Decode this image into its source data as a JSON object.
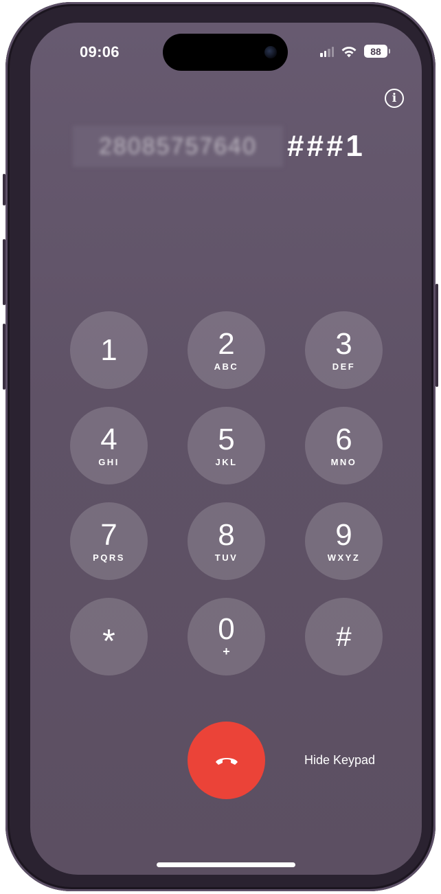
{
  "status_bar": {
    "time": "09:06",
    "battery": "88",
    "icons": [
      "cellular-signal-icon",
      "wifi-icon",
      "battery-icon"
    ]
  },
  "call": {
    "number_hidden": "28085757640",
    "dialed_suffix": "###1",
    "info_icon": "info-icon"
  },
  "keypad": {
    "keys": [
      {
        "digit": "1",
        "letters": ""
      },
      {
        "digit": "2",
        "letters": "ABC"
      },
      {
        "digit": "3",
        "letters": "DEF"
      },
      {
        "digit": "4",
        "letters": "GHI"
      },
      {
        "digit": "5",
        "letters": "JKL"
      },
      {
        "digit": "6",
        "letters": "MNO"
      },
      {
        "digit": "7",
        "letters": "PQRS"
      },
      {
        "digit": "8",
        "letters": "TUV"
      },
      {
        "digit": "9",
        "letters": "WXYZ"
      },
      {
        "digit": "*",
        "letters": ""
      },
      {
        "digit": "0",
        "letters": "+"
      },
      {
        "digit": "#",
        "letters": ""
      }
    ]
  },
  "actions": {
    "end_call_icon": "end-call-icon",
    "hide_keypad_label": "Hide Keypad"
  },
  "colors": {
    "screen_bg": "#5f5266",
    "key_bg": "rgba(255,255,255,0.16)",
    "end_call": "#eb4338"
  }
}
